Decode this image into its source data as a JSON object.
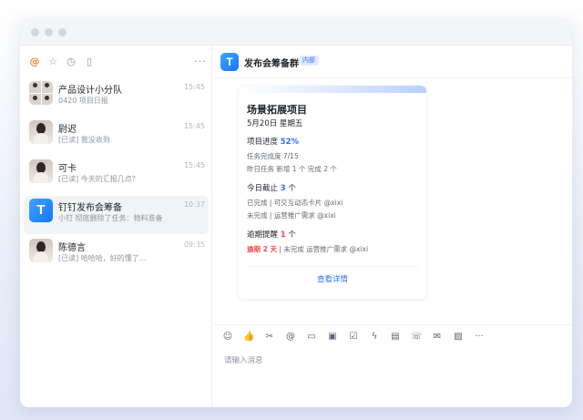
{
  "sidebar": {
    "toolbar_more": "···",
    "conversations": [
      {
        "name": "产品设计小分队",
        "preview": "0420 项目日报",
        "time": "15:45",
        "avatar": "group"
      },
      {
        "name": "尉迟",
        "preview": "[已读] 我没收到",
        "time": "15:45",
        "avatar": "photo"
      },
      {
        "name": "可卡",
        "preview": "[已读] 今天的汇报几点？",
        "time": "15:45",
        "avatar": "photo"
      },
      {
        "name": "钉钉发布会筹备",
        "preview": "小钉 彻底删除了任务：物料准备",
        "time": "10:37",
        "avatar": "app",
        "active": true
      },
      {
        "name": "陈德言",
        "preview": "[已读] 哈哈哈，好的懂了...",
        "time": "09:35",
        "avatar": "photo"
      }
    ]
  },
  "chat": {
    "title": "发布会筹备群",
    "tag": "内部",
    "card": {
      "title": "场景拓展项目",
      "date": "5月20日 星期五",
      "progress_label": "项目进度",
      "progress_value": "52%",
      "progress_fraction": 0.52,
      "progress_line1": "任务完成度 7/15",
      "progress_line2": "昨日任务 新增 1 个 完成 2 个",
      "deadline_label": "今日截止",
      "deadline_count": "3",
      "deadline_unit": "个",
      "deadline_line1": "已完成 | 可交互动态卡片 @xixi",
      "deadline_line2": "未完成 | 运营推广需求 @xixi",
      "overdue_label": "逾期提醒",
      "overdue_count": "1",
      "overdue_unit": "个",
      "overdue_tag": "逾期 2 天",
      "overdue_line": " | 未完成 运营推广需求 @xixi",
      "link": "查看详情"
    },
    "composer": {
      "placeholder": "请输入消息",
      "tools": [
        "emoji-icon",
        "thumbs-up-icon",
        "scissors-icon",
        "at-icon",
        "folder-icon",
        "doc-icon",
        "checkbox-icon",
        "bolt-icon",
        "calendar-icon",
        "phone-icon",
        "mail-icon",
        "image-icon",
        "more-icon"
      ]
    }
  },
  "colors": {
    "accent": "#3370ff",
    "overdue": "#f54a45",
    "mention": "#ff7d2b"
  }
}
